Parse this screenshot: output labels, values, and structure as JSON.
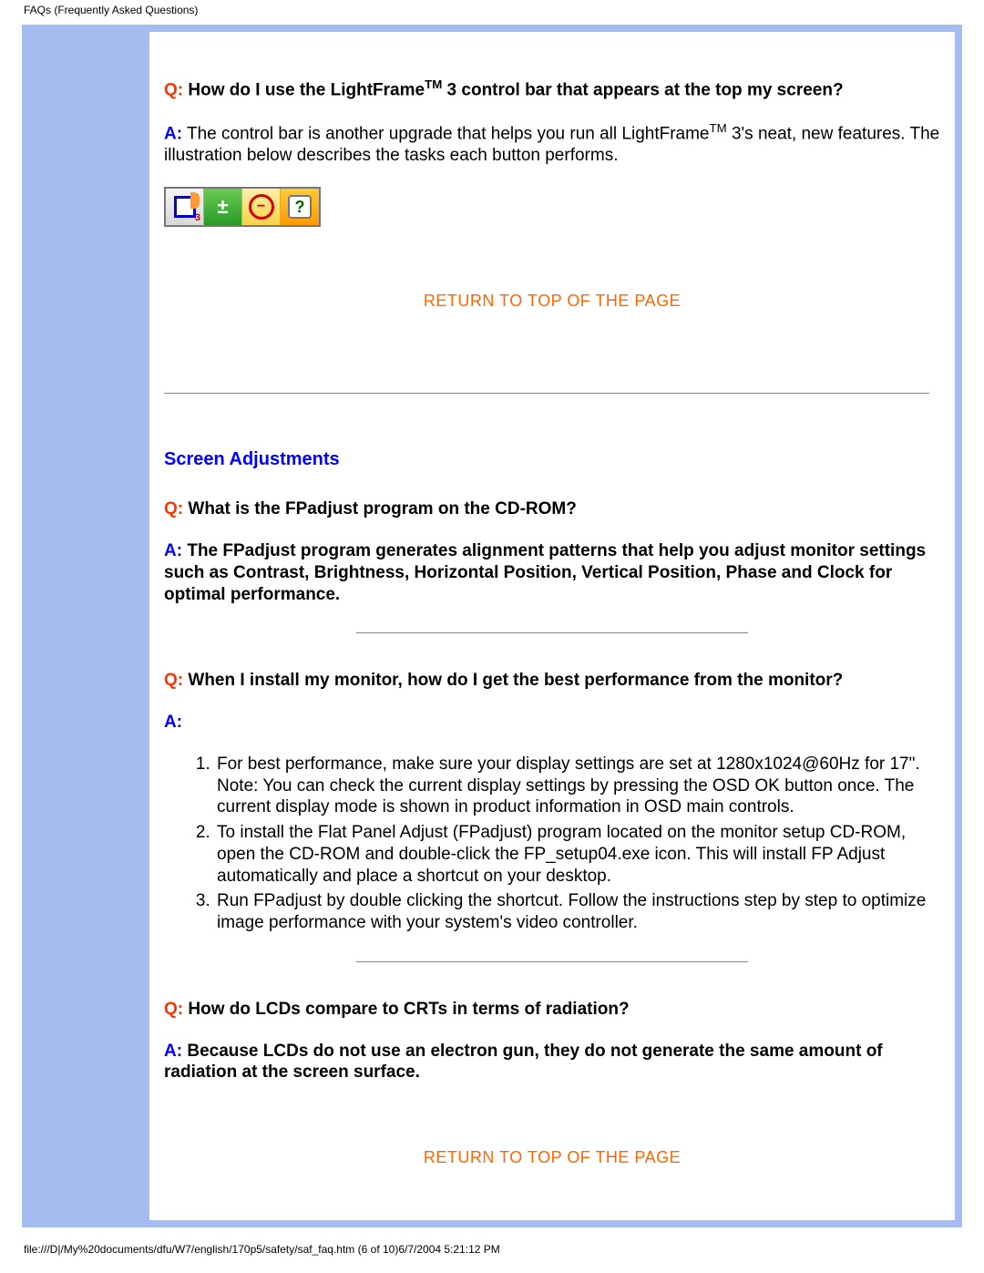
{
  "header": "FAQs (Frequently Asked Questions)",
  "q1": {
    "q_prefix": "Q:",
    "q_text_a": " How do I use the LightFrame",
    "q_sup": "TM",
    "q_text_b": " 3 control bar that appears at the top my screen?",
    "a_prefix": "A:",
    "a_text_a": " The control bar is another upgrade that helps you run all LightFrame",
    "a_sup": "TM",
    "a_text_b": " 3's neat, new features. The illustration below describes the tasks each button performs."
  },
  "return_link": "RETURN TO TOP OF THE PAGE",
  "section_heading": "Screen Adjustments",
  "q2": {
    "q_prefix": "Q:",
    "q_text": " What is the FPadjust program on the CD-ROM?",
    "a_prefix": "A:",
    "a_text": " The FPadjust program generates alignment patterns that help you adjust monitor settings such as Contrast, Brightness, Horizontal Position, Vertical Position, Phase and Clock for optimal performance."
  },
  "q3": {
    "q_prefix": "Q:",
    "q_text": " When I install my monitor, how do I get the best performance from the monitor?",
    "a_prefix": "A:",
    "steps": [
      "For best performance, make sure your display settings are set at 1280x1024@60Hz for 17\". Note: You can check the current display settings by pressing the OSD OK button once. The current display mode is shown in product information in OSD main controls.",
      "To install the Flat Panel Adjust (FPadjust) program located on the monitor setup CD-ROM, open the CD-ROM and double-click the FP_setup04.exe icon. This will install FP Adjust automatically and place a shortcut on your desktop.",
      "Run FPadjust by double clicking the shortcut. Follow the instructions step by step to optimize image performance with your system's video controller."
    ]
  },
  "q4": {
    "q_prefix": "Q:",
    "q_text": " How do LCDs compare to CRTs in terms of radiation?",
    "a_prefix": "A:",
    "a_text": " Because LCDs do not use an electron gun, they do not generate the same amount of radiation at the screen surface."
  },
  "footer": "file:///D|/My%20documents/dfu/W7/english/170p5/safety/saf_faq.htm (6 of 10)6/7/2004 5:21:12 PM"
}
